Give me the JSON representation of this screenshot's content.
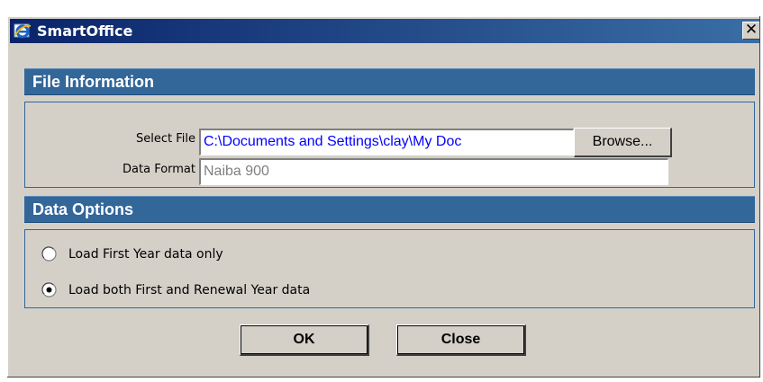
{
  "window": {
    "title": "SmartOffice",
    "close_label": "✕",
    "icon": "internet-explorer-icon"
  },
  "file_information": {
    "header": "File Information",
    "select_file_label": "Select File",
    "select_file_value": "C:\\Documents and Settings\\clay\\My Doc",
    "browse_label": "Browse...",
    "data_format_label": "Data Format",
    "data_format_value": "Naiba 900"
  },
  "data_options": {
    "header": "Data Options",
    "options": [
      {
        "label": "Load First Year data only",
        "selected": false
      },
      {
        "label": "Load both First and Renewal Year data",
        "selected": true
      }
    ]
  },
  "buttons": {
    "ok_label": "OK",
    "close_label": "Close"
  },
  "colors": {
    "title_bar_start": "#0a246a",
    "title_bar_end": "#3a6ea5",
    "section_header": "#336699",
    "dialog_face": "#d4d0c8",
    "file_path_text": "#0000ff"
  }
}
